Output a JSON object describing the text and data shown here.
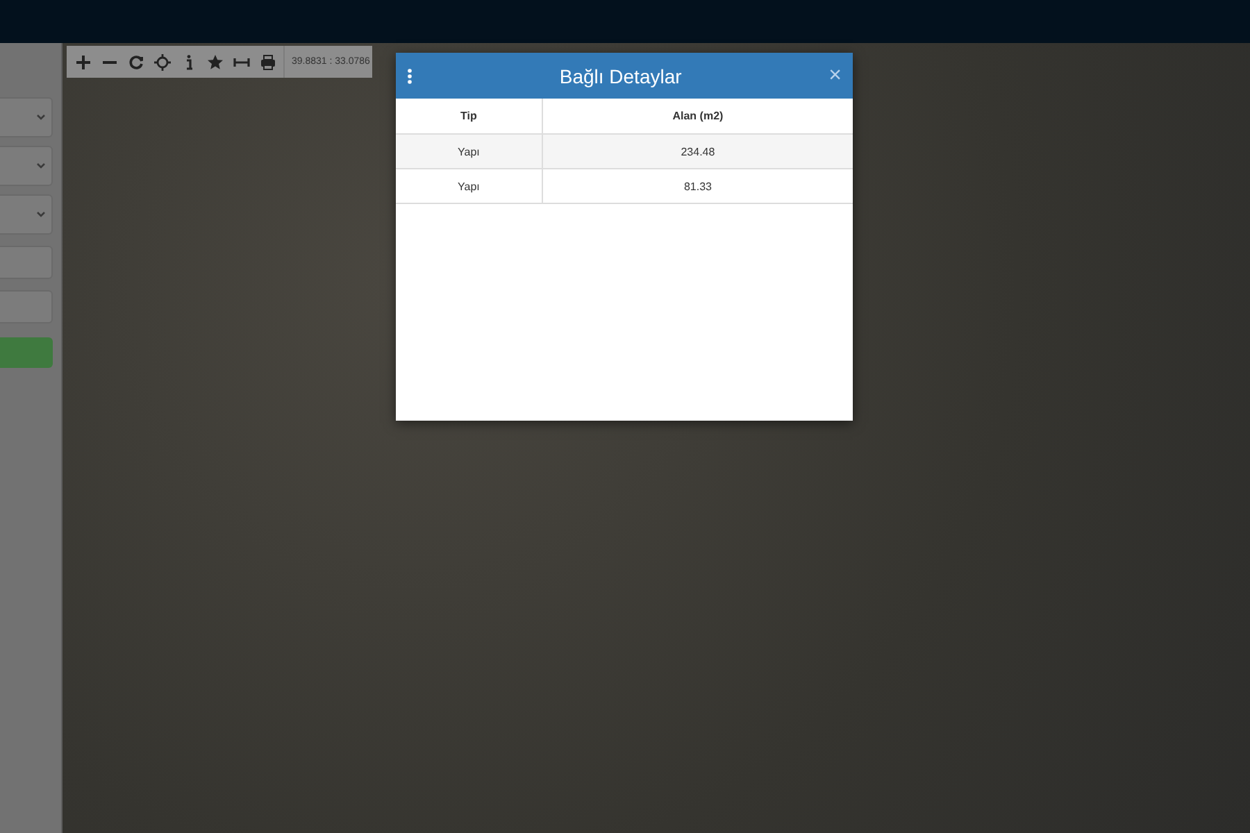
{
  "toolbar": {
    "coordinates": "39.8831 : 33.0786"
  },
  "dialog": {
    "title": "Bağlı Detaylar",
    "close": "×",
    "columns": [
      "Tip",
      "Alan (m2)"
    ],
    "rows": [
      [
        "Yapı",
        "234.48"
      ],
      [
        "Yapı",
        "81.33"
      ]
    ]
  }
}
